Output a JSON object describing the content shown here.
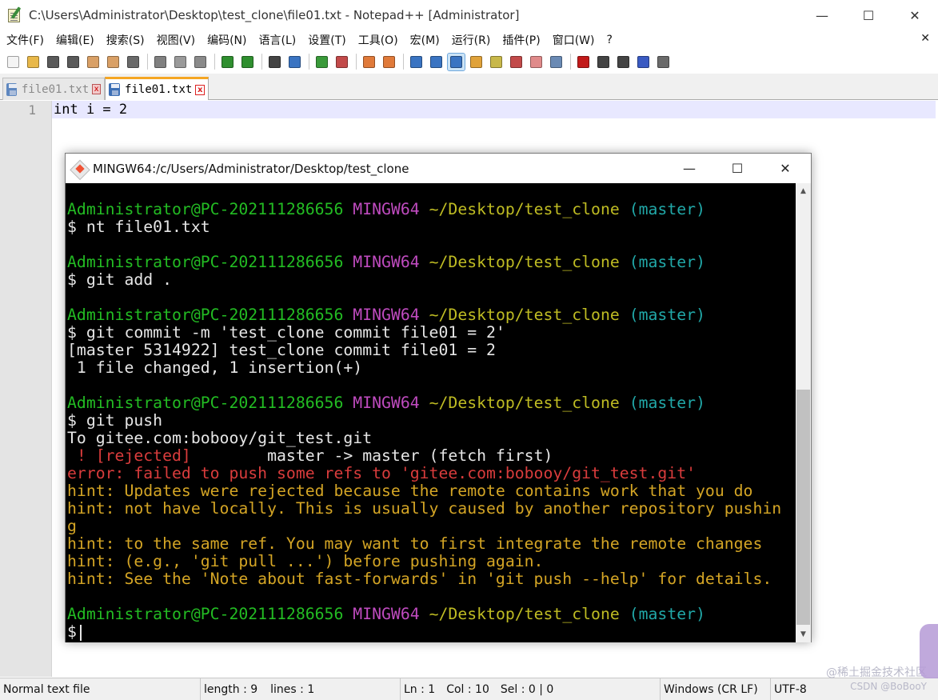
{
  "window": {
    "title": "C:\\Users\\Administrator\\Desktop\\test_clone\\file01.txt - Notepad++ [Administrator]",
    "minimize": "—",
    "maximize": "☐",
    "close": "✕"
  },
  "menu": {
    "items": [
      "文件(F)",
      "编辑(E)",
      "搜索(S)",
      "视图(V)",
      "编码(N)",
      "语言(L)",
      "设置(T)",
      "工具(O)",
      "宏(M)",
      "运行(R)",
      "插件(P)",
      "窗口(W)",
      "?"
    ],
    "close_doc": "✕"
  },
  "toolbar": {
    "buttons": [
      {
        "icon": "new-file-icon",
        "color": "#f4f4f4"
      },
      {
        "icon": "open-file-icon",
        "color": "#e8b84a"
      },
      {
        "icon": "save-icon",
        "color": "#5a5a5a"
      },
      {
        "icon": "save-all-icon",
        "color": "#5a5a5a"
      },
      {
        "icon": "close-icon",
        "color": "#d9a066"
      },
      {
        "icon": "close-all-icon",
        "color": "#d9a066"
      },
      {
        "icon": "print-icon",
        "color": "#6a6a6a"
      },
      {
        "sep": true
      },
      {
        "icon": "cut-icon",
        "color": "#808080"
      },
      {
        "icon": "copy-icon",
        "color": "#9a9a9a"
      },
      {
        "icon": "paste-icon",
        "color": "#8a8a8a"
      },
      {
        "sep": true
      },
      {
        "icon": "undo-icon",
        "color": "#2f8f2f"
      },
      {
        "icon": "redo-icon",
        "color": "#2f8f2f"
      },
      {
        "sep": true
      },
      {
        "icon": "find-icon",
        "color": "#444444"
      },
      {
        "icon": "replace-icon",
        "color": "#3a74c2"
      },
      {
        "sep": true
      },
      {
        "icon": "zoom-in-icon",
        "color": "#3a9a3a"
      },
      {
        "icon": "zoom-out-icon",
        "color": "#c24a4a"
      },
      {
        "sep": true
      },
      {
        "icon": "sync-vertical-icon",
        "color": "#e07a3a"
      },
      {
        "icon": "sync-horizontal-icon",
        "color": "#e07a3a"
      },
      {
        "sep": true
      },
      {
        "icon": "word-wrap-icon",
        "color": "#3a74c2"
      },
      {
        "icon": "show-all-chars-icon",
        "color": "#3a74c2"
      },
      {
        "icon": "indent-guide-icon",
        "color": "#3a74c2",
        "active": true
      },
      {
        "icon": "language-icon",
        "color": "#e0a23a"
      },
      {
        "icon": "doc-map-icon",
        "color": "#c8b84a"
      },
      {
        "icon": "function-list-icon",
        "color": "#c24a4a"
      },
      {
        "icon": "folder-workspace-icon",
        "color": "#e08a8a"
      },
      {
        "icon": "monitoring-icon",
        "color": "#6a8ab4"
      },
      {
        "sep": true
      },
      {
        "icon": "record-macro-icon",
        "color": "#c21a1a"
      },
      {
        "icon": "stop-macro-icon",
        "color": "#444444"
      },
      {
        "icon": "play-macro-icon",
        "color": "#444444"
      },
      {
        "icon": "play-multiple-icon",
        "color": "#3a5ac2"
      },
      {
        "icon": "save-macro-icon",
        "color": "#6a6a6a"
      }
    ]
  },
  "tabs": [
    {
      "label": "file01.txt",
      "active": false
    },
    {
      "label": "file01.txt",
      "active": true
    }
  ],
  "editor": {
    "line_number": "1",
    "content": "int i = 2"
  },
  "terminal": {
    "title": "MINGW64:/c/Users/Administrator/Desktop/test_clone",
    "prompt": {
      "user": "Administrator@PC-202111286656",
      "env": "MINGW64",
      "path": "~/Desktop/test_clone",
      "branch": "(master)"
    },
    "cmd1": "$ nt file01.txt",
    "cmd2": "$ git add .",
    "cmd3": "$ git commit -m 'test_clone commit file01 = 2'",
    "out3a": "[master 5314922] test_clone commit file01 = 2",
    "out3b": " 1 file changed, 1 insertion(+)",
    "cmd4": "$ git push",
    "out4a": "To gitee.com:bobooy/git_test.git",
    "out4b_red": " ! [rejected]",
    "out4b_rest": "        master -> master (fetch first)",
    "out4c": "error: failed to push some refs to 'gitee.com:bobooy/git_test.git'",
    "hint1": "hint: Updates were rejected because the remote contains work that you do",
    "hint2": "hint: not have locally. This is usually caused by another repository pushin",
    "hint2b": "g",
    "hint3": "hint: to the same ref. You may want to first integrate the remote changes",
    "hint4": "hint: (e.g., 'git pull ...') before pushing again.",
    "hint5": "hint: See the 'Note about fast-forwards' in 'git push --help' for details.",
    "cmd5": "$"
  },
  "status": {
    "type": "Normal text file",
    "length": "length : 9",
    "lines": "lines : 1",
    "ln": "Ln : 1",
    "col": "Col : 10",
    "sel": "Sel : 0 | 0",
    "eol": "Windows (CR LF)",
    "encoding": "UTF-8",
    "watermark1": "@稀土掘金技术社区",
    "watermark2": "CSDN @BoBooY"
  },
  "colors": {
    "prompt_green": "#23bc23",
    "prompt_purple": "#bf4bbf",
    "prompt_yellow": "#bfbc23",
    "prompt_cyan": "#21a8a8",
    "error_red": "#d93c3c",
    "hint_gold": "#d4a525"
  }
}
